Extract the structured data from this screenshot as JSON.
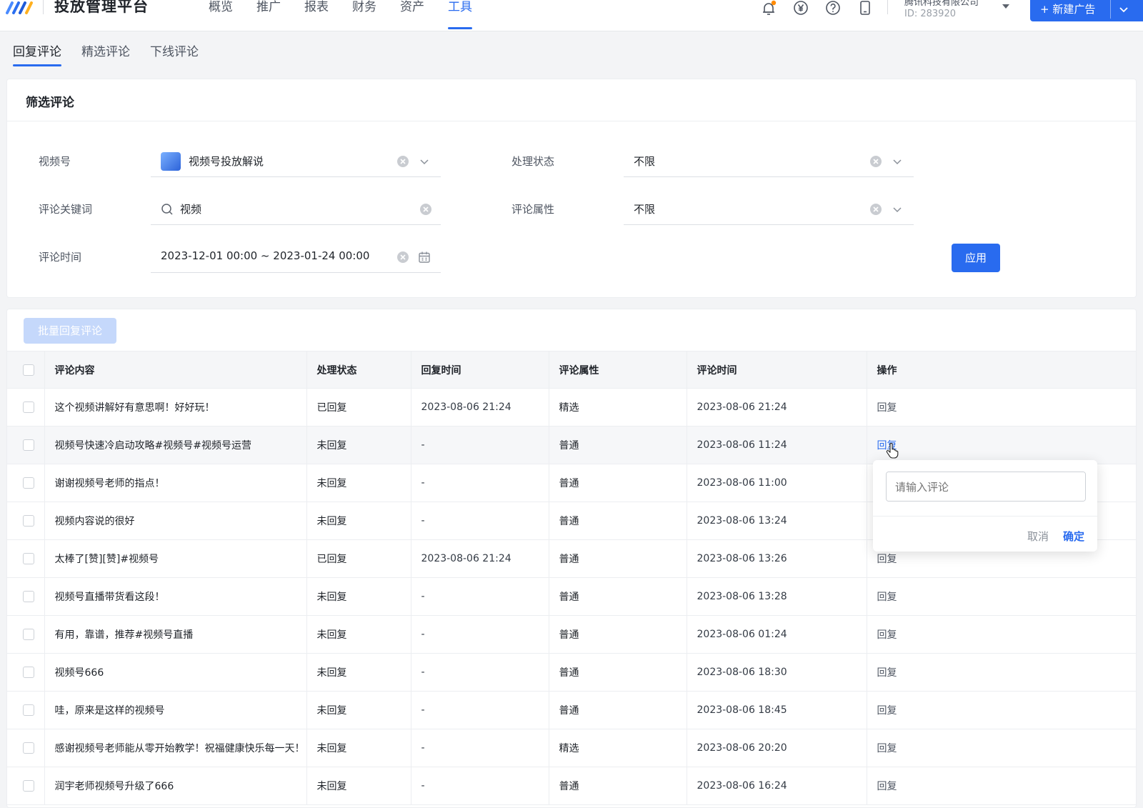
{
  "header": {
    "title": "投放管理平台",
    "nav": [
      "概览",
      "推广",
      "报表",
      "财务",
      "资产",
      "工具"
    ],
    "active_nav": "工具",
    "company_name": "腾讯科技有限公司",
    "company_id": "ID: 283920",
    "new_ad_label": "+ 新建广告",
    "icons": [
      "bell-icon",
      "yuan-icon",
      "help-icon",
      "mobile-icon"
    ],
    "notification_dot_color": "#ff8a00"
  },
  "subtabs": [
    "回复评论",
    "精选评论",
    "下线评论"
  ],
  "filter": {
    "title": "筛选评论",
    "channel_label": "视频号",
    "channel_value": "视频号投放解说",
    "keyword_label": "评论关键词",
    "keyword_value": "视频",
    "time_label": "评论时间",
    "time_value": "2023-12-01 00:00 ~ 2023-01-24 00:00",
    "status_label": "处理状态",
    "status_value": "不限",
    "attr_label": "评论属性",
    "attr_value": "不限",
    "apply_label": "应用"
  },
  "table": {
    "batch_label": "批量回复评论",
    "columns": [
      "评论内容",
      "处理状态",
      "回复时间",
      "评论属性",
      "评论时间",
      "操作"
    ],
    "rows": [
      {
        "content": "这个视频讲解好有意思啊！好好玩！",
        "status": "已回复",
        "reply_time": "2023-08-06 21:24",
        "attr": "精选",
        "time": "2023-08-06 21:24",
        "action": "回复"
      },
      {
        "content": "视频号快速冷启动攻略#视频号#视频号运营",
        "status": "未回复",
        "reply_time": "-",
        "attr": "普通",
        "time": "2023-08-06 11:24",
        "action": "回复"
      },
      {
        "content": "谢谢视频号老师的指点！",
        "status": "未回复",
        "reply_time": "-",
        "attr": "普通",
        "time": "2023-08-06 11:00",
        "action": "回复"
      },
      {
        "content": "视频内容说的很好",
        "status": "未回复",
        "reply_time": "-",
        "attr": "普通",
        "time": "2023-08-06 13:24",
        "action": "回复"
      },
      {
        "content": "太棒了[赞][赞]#视频号",
        "status": "已回复",
        "reply_time": "2023-08-06 21:24",
        "attr": "普通",
        "time": "2023-08-06 13:26",
        "action": "回复"
      },
      {
        "content": "视频号直播带货看这段！",
        "status": "未回复",
        "reply_time": "-",
        "attr": "普通",
        "time": "2023-08-06 13:28",
        "action": "回复"
      },
      {
        "content": "有用，靠谱，推荐#视频号直播",
        "status": "未回复",
        "reply_time": "-",
        "attr": "普通",
        "time": "2023-08-06 01:24",
        "action": "回复"
      },
      {
        "content": "视频号666",
        "status": "未回复",
        "reply_time": "-",
        "attr": "普通",
        "time": "2023-08-06 18:30",
        "action": "回复"
      },
      {
        "content": "哇，原来是这样的视频号",
        "status": "未回复",
        "reply_time": "-",
        "attr": "普通",
        "time": "2023-08-06 18:45",
        "action": "回复"
      },
      {
        "content": "感谢视频号老师能从零开始教学！祝福健康快乐每一天！",
        "status": "未回复",
        "reply_time": "-",
        "attr": "精选",
        "time": "2023-08-06 20:20",
        "action": "回复"
      },
      {
        "content": "润宇老师视频号升级了666",
        "status": "未回复",
        "reply_time": "-",
        "attr": "普通",
        "time": "2023-08-06 16:24",
        "action": "回复"
      }
    ]
  },
  "popover": {
    "placeholder": "请输入评论",
    "cancel_label": "取消",
    "confirm_label": "确定"
  },
  "colors": {
    "accent": "#296bef",
    "batch_disabled": "#c5d8fb"
  }
}
